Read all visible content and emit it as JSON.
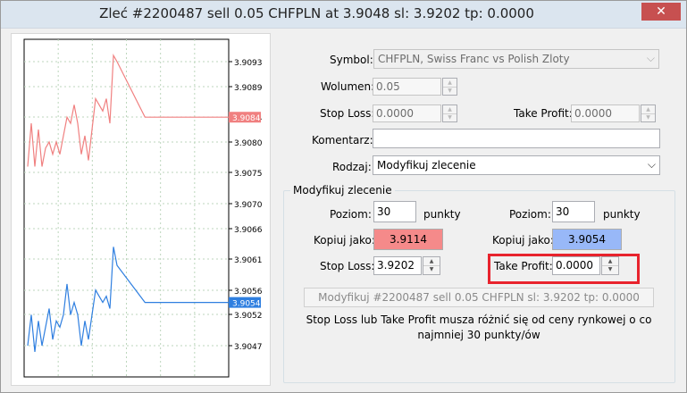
{
  "window": {
    "title": "Zleć #2200487 sell 0.05 CHFPLN at 3.9048 sl: 3.9202 tp: 0.0000",
    "close_icon": "close-icon"
  },
  "chart": {
    "ticks": [
      "3.9093",
      "3.9089",
      "3.9084",
      "3.9080",
      "3.9075",
      "3.9070",
      "3.9066",
      "3.9061",
      "3.9056",
      "3.9052",
      "3.9047"
    ],
    "ask_price": "3.9084",
    "bid_price": "3.9054",
    "ask_color": "#f08080",
    "bid_color": "#2f7fe0",
    "ask_series": [
      3.9076,
      3.9083,
      3.9076,
      3.9082,
      3.9076,
      3.9079,
      3.908,
      3.9078,
      3.908,
      3.9078,
      3.9081,
      3.9084,
      3.9083,
      3.9086,
      3.9083,
      3.9078,
      3.9081,
      3.9077,
      3.9082,
      3.9087,
      3.9086,
      3.9085,
      3.9087,
      3.9083,
      3.9094,
      3.9093,
      3.9084,
      3.9084,
      3.9084,
      3.9084
    ],
    "bid_series": [
      3.9047,
      3.9052,
      3.9046,
      3.9051,
      3.9047,
      3.905,
      3.9053,
      3.9048,
      3.9051,
      3.905,
      3.9052,
      3.9057,
      3.9052,
      3.9054,
      3.9052,
      3.9047,
      3.9051,
      3.9048,
      3.9052,
      3.9056,
      3.9055,
      3.9054,
      3.9055,
      3.9053,
      3.9063,
      3.906,
      3.9054,
      3.9054,
      3.9054,
      3.9054
    ]
  },
  "form": {
    "symbol_label": "Symbol:",
    "symbol_value": "CHFPLN, Swiss Franc vs Polish Zloty",
    "volume_label": "Wolumen:",
    "volume_value": "0.05",
    "stoploss_label": "Stop Loss:",
    "stoploss_value": "0.0000",
    "takeprofit_label": "Take Profit:",
    "takeprofit_value": "0.0000",
    "comment_label": "Komentarz:",
    "comment_value": "",
    "type_label": "Rodzaj:",
    "type_value": "Modyfikuj zlecenie"
  },
  "modify": {
    "group_label": "Modyfikuj zlecenie",
    "level_label": "Poziom:",
    "level_left_value": "30",
    "level_right_value": "30",
    "points_label": "punkty",
    "copy_label": "Kopiuj jako:",
    "copy_left_value": "3.9114",
    "copy_right_value": "3.9054",
    "copy_left_color": "#f58a8a",
    "copy_right_color": "#98b8f8",
    "sl_label": "Stop Loss:",
    "sl_value": "3.9202",
    "tp_label": "Take Profit:",
    "tp_value": "0.0000",
    "modify_button": "Modyfikuj #2200487 sell 0.05 CHFPLN sl: 3.9202 tp: 0.0000",
    "note": "Stop Loss lub Take Profit musza różnić się od ceny rynkowej o co najmniej 30 punkty/ów"
  }
}
